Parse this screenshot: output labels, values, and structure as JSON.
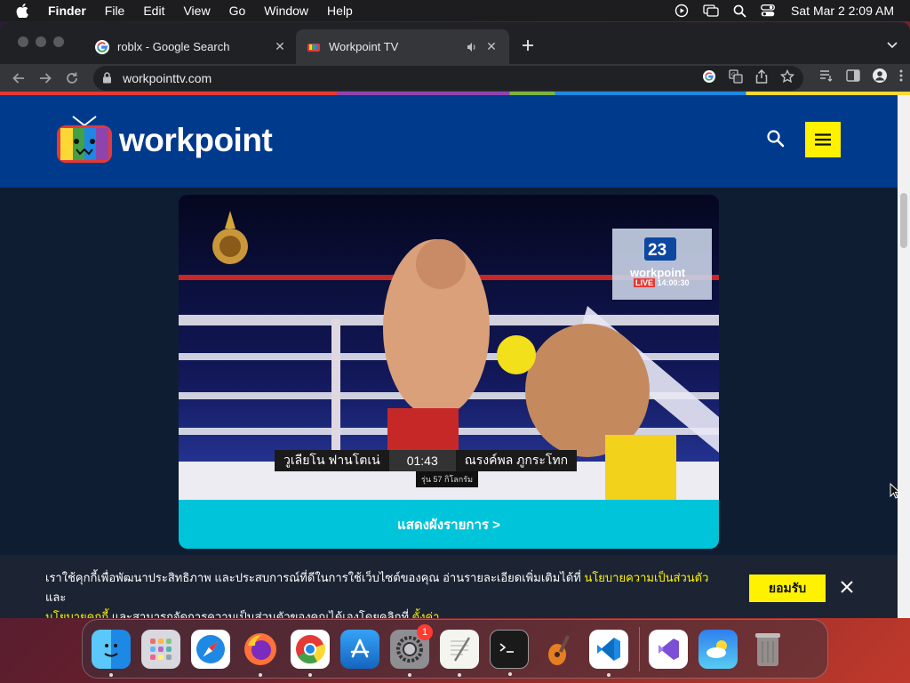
{
  "menubar": {
    "app_name": "Finder",
    "menus": [
      "File",
      "Edit",
      "View",
      "Go",
      "Window",
      "Help"
    ],
    "clock": "Sat Mar 2  2:09 AM"
  },
  "browser": {
    "tabs": [
      {
        "title": "roblx - Google Search",
        "favicon": "google-icon",
        "active": false
      },
      {
        "title": "Workpoint TV",
        "favicon": "workpoint-icon",
        "active": true,
        "audio": true
      }
    ],
    "url": "workpointtv.com"
  },
  "site": {
    "logo_text": "workpoint",
    "accent": "#fff200",
    "header_color": "#003a8c"
  },
  "player": {
    "fighter_left": "วูเลียโน ฟานโตเน่",
    "round_time": "01:43",
    "fighter_right": "ณรงค์พล ภูกระโทก",
    "weight_class": "รุ่น 57 กิโลกรัม",
    "channel_number": "23",
    "channel_name": "workpoint",
    "live_label": "LIVE",
    "live_time": "14:00:30",
    "show_schedule": "แสดงผังรายการ >"
  },
  "cookie": {
    "text_1": "เราใช้คุกกี้เพื่อพัฒนาประสิทธิภาพ และประสบการณ์ที่ดีในการใช้เว็บไซต์ของคุณ อ่านรายละเอียดเพิ่มเติมได้ที่ ",
    "privacy_link": "นโยบายความเป็นส่วนตัว",
    "text_2": " และ",
    "cookie_policy_link": "นโยบายคุกกี้",
    "text_3": " และสามารถจัดการความเป็นส่วนตัวของคุณได้เองโดยคลิกที่ ",
    "settings_link": "ตั้งค่า",
    "accept": "ยอมรับ"
  },
  "dock": {
    "items": [
      "finder",
      "launchpad",
      "safari",
      "firefox",
      "chrome",
      "app-store",
      "system-settings",
      "textedit",
      "terminal",
      "garageband",
      "vscode",
      "visual-studio",
      "weather",
      "trash"
    ],
    "system_settings_badge": "1"
  }
}
